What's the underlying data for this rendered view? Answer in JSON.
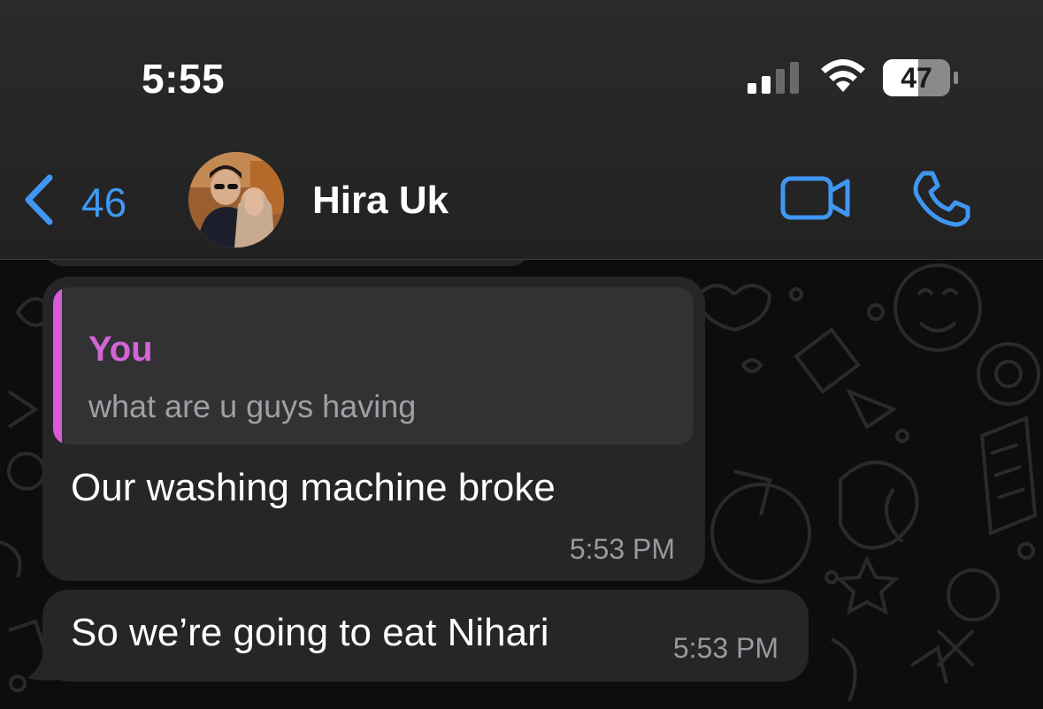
{
  "status_bar": {
    "time": "5:55",
    "battery": "47",
    "signal_icon": "cellular-signal-icon",
    "wifi_icon": "wifi-icon",
    "battery_icon": "battery-icon"
  },
  "header": {
    "back_count": "46",
    "back_icon": "chevron-left-icon",
    "contact_name": "Hira Uk",
    "video_icon": "video-camera-icon",
    "phone_icon": "phone-icon",
    "accent_color": "#3f97f3"
  },
  "messages": [
    {
      "reply_to": {
        "author": "You",
        "text": "what are u guys having",
        "accent_color": "#d265d6"
      },
      "text": "Our washing machine broke",
      "time": "5:53 PM"
    },
    {
      "text": "So we’re going to eat Nihari",
      "time": "5:53 PM"
    }
  ]
}
